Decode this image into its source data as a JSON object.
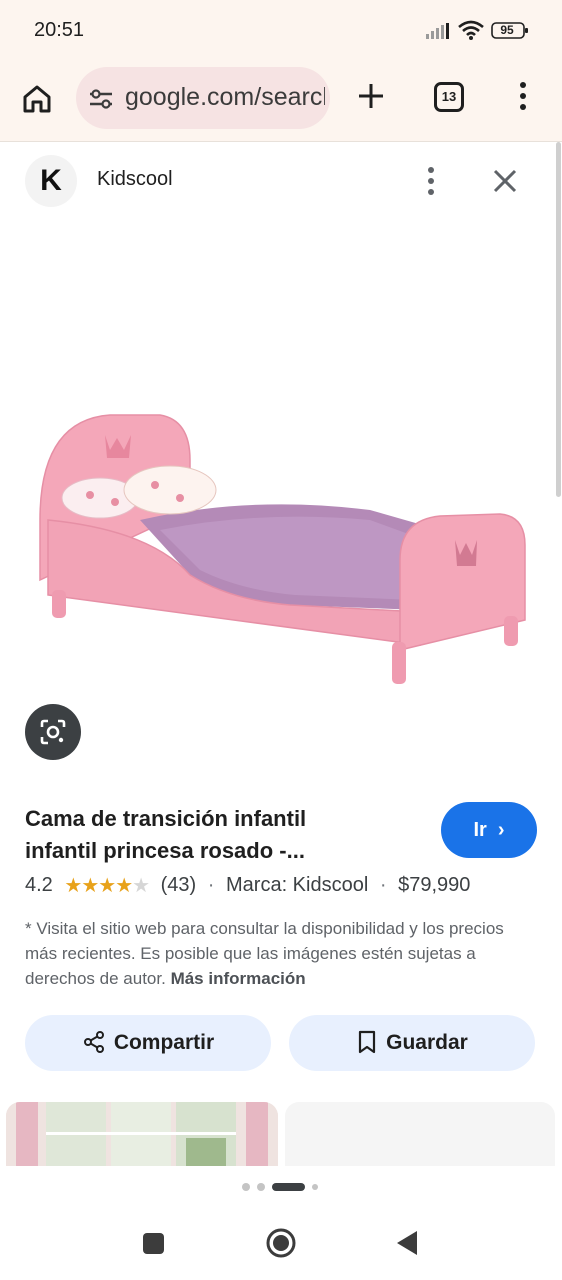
{
  "status_bar": {
    "time": "20:51",
    "battery": "95"
  },
  "browser": {
    "url": "google.com/search",
    "tab_count": "13"
  },
  "panel": {
    "source_initial": "K",
    "source_name": "Kidscool"
  },
  "product": {
    "title_line1": "Cama de transición infantil",
    "title_line2": "infantil princesa rosado -...",
    "go_label": "Ir",
    "rating": "4.2",
    "rating_stars_filled": 4,
    "rating_count": "(43)",
    "brand": "Marca: Kidscool",
    "price": "$79,990",
    "disclaimer": "* Visita el sitio web para consultar la disponibilidad y los precios más recientes. Es posible que las imágenes estén sujetas a derechos de autor.",
    "more_info": "Más información"
  },
  "actions": {
    "share_label": "Compartir",
    "save_label": "Guardar"
  },
  "icons": [
    "home-icon",
    "tune-icon",
    "plus-icon",
    "tabs-icon",
    "more-vert-icon",
    "close-icon",
    "lens-icon",
    "share-icon",
    "bookmark-icon"
  ],
  "colors": {
    "accent": "#1a73e8",
    "toolbar": "#fdf5ef",
    "url_pill": "#f6e3e3",
    "star": "#e8a21b",
    "chip_bg": "#e8f0fe"
  }
}
